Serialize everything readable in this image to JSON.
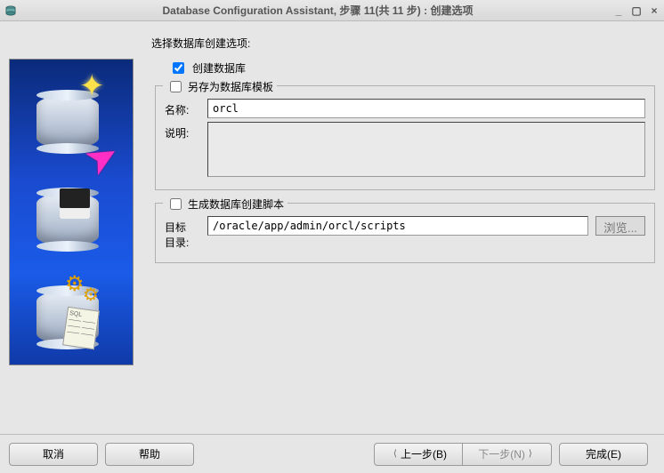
{
  "titlebar": {
    "title": "Database Configuration Assistant, 步骤 11(共 11 步) : 创建选项"
  },
  "main": {
    "heading": "选择数据库创建选项:",
    "create_db_label": "创建数据库",
    "create_db_checked": true,
    "save_template": {
      "legend": "另存为数据库模板",
      "checked": false,
      "name_label": "名称:",
      "name_value": "orcl",
      "desc_label": "说明:",
      "desc_value": ""
    },
    "gen_scripts": {
      "legend": "生成数据库创建脚本",
      "checked": false,
      "dir_label_line1": "目标",
      "dir_label_line2": "目录:",
      "dir_value": "/oracle/app/admin/orcl/scripts",
      "browse_label": "浏览..."
    }
  },
  "footer": {
    "cancel": "取消",
    "help": "帮助",
    "back": "上一步(B)",
    "next": "下一步(N)",
    "finish": "完成(E)"
  }
}
